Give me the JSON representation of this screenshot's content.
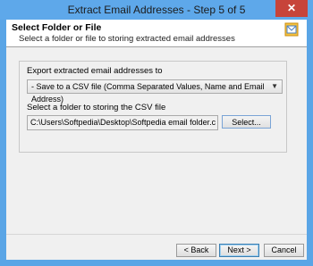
{
  "window": {
    "title": "Extract Email Addresses - Step 5 of 5",
    "close_glyph": "✕"
  },
  "header": {
    "title": "Select Folder or File",
    "subtitle": "Select a folder or file to storing extracted email addresses",
    "icon": "outlook-icon"
  },
  "export": {
    "group_label": "Export extracted email addresses to",
    "format_selected": "- Save to a CSV file (Comma Separated Values, Name and Email Address)",
    "folder_label": "Select a folder to storing the CSV file",
    "folder_path": "C:\\Users\\Softpedia\\Desktop\\Softpedia email folder.csv",
    "select_label": "Select..."
  },
  "footer": {
    "back_label": "< Back",
    "next_label": "Next >",
    "cancel_label": "Cancel"
  },
  "colors": {
    "titlebar": "#5ea8ea",
    "close": "#c7443a",
    "panel": "#f0f0f0"
  }
}
